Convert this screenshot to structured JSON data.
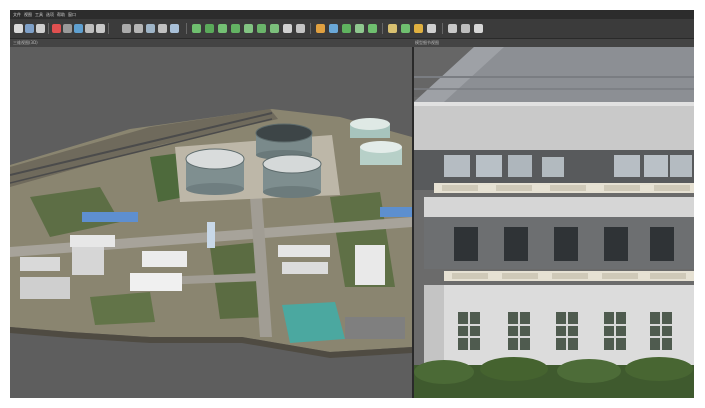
{
  "menubar": {
    "items": [
      "文件",
      "视图",
      "工具",
      "选项",
      "帮助",
      "窗口"
    ]
  },
  "panels": {
    "left_title": "三维视图(3D)",
    "right_title": "模型细节视图"
  },
  "colors": {
    "window_bg": "#3a3a3a",
    "toolbar_bg": "#3b3b3b",
    "viewport_bg": "#5f5f5f"
  },
  "toolbar": {
    "icons": [
      "open-icon",
      "save-icon",
      "new-icon",
      "cut-icon",
      "copy-icon",
      "settings-icon",
      "grid-icon",
      "layers-icon",
      "list-icon",
      "image-icon",
      "measure-icon",
      "select-icon",
      "move-icon",
      "rotate-icon",
      "scale-icon",
      "terrain-icon",
      "cube-icon",
      "brush-icon",
      "erase-icon",
      "fill-icon",
      "stamp-icon",
      "camera-icon",
      "target-icon",
      "star-icon",
      "marker-icon",
      "import-icon",
      "export-icon",
      "folder-icon",
      "ruler-icon",
      "info-icon",
      "help-icon"
    ]
  }
}
